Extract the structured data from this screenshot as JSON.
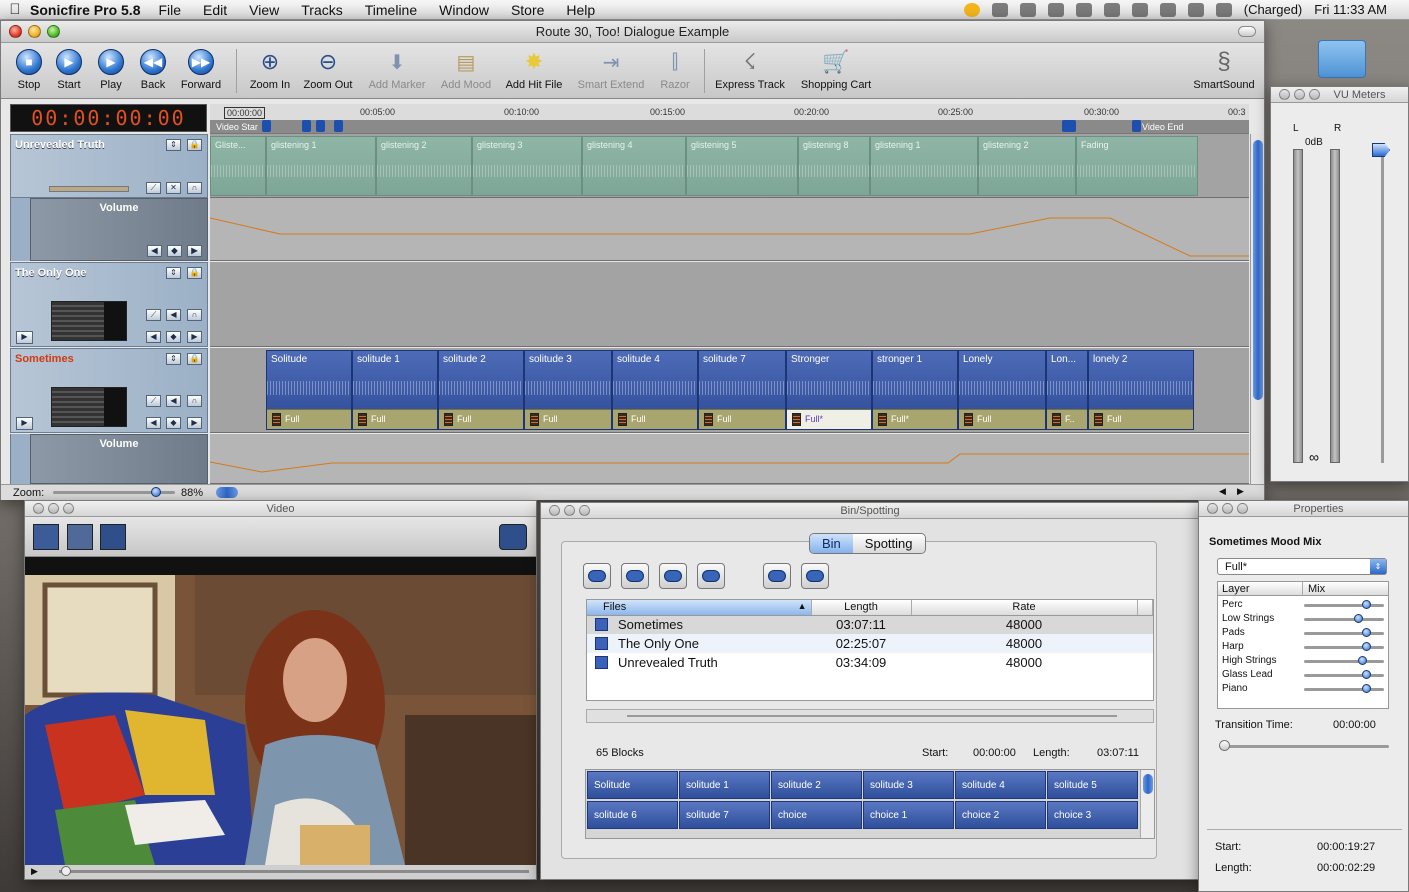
{
  "menubar": {
    "app_name": "Sonicfire Pro 5.8",
    "items": [
      "File",
      "Edit",
      "View",
      "Tracks",
      "Timeline",
      "Window",
      "Store",
      "Help"
    ],
    "battery": "(Charged)",
    "clock": "Fri 11:33 AM"
  },
  "main_window": {
    "title": "Route 30, Too! Dialogue Example",
    "toolbar": {
      "stop": "Stop",
      "start": "Start",
      "play": "Play",
      "back": "Back",
      "forward": "Forward",
      "zoom_in": "Zoom In",
      "zoom_out": "Zoom Out",
      "add_marker": "Add Marker",
      "add_mood": "Add Mood",
      "add_hit_file": "Add Hit File",
      "smart_extend": "Smart Extend",
      "razor": "Razor",
      "express_track": "Express Track",
      "shopping_cart": "Shopping Cart",
      "smartsound": "SmartSound"
    },
    "timecode": "00:00:00:00",
    "ruler_ticks": [
      "00:00:00",
      "00:05:00",
      "00:10:00",
      "00:15:00",
      "00:20:00",
      "00:25:00",
      "00:30:00",
      "00:3"
    ],
    "video_start": "Video Star",
    "video_end": "Video End",
    "tracks": {
      "unrevealed": {
        "name": "Unrevealed Truth",
        "blocks": [
          "Gliste...",
          "glistening 1",
          "glistening 2",
          "glistening 3",
          "glistening 4",
          "glistening 5",
          "glistening 8",
          "glistening 1",
          "glistening 2",
          "Fading"
        ]
      },
      "volume_label": "Volume",
      "only_one": {
        "name": "The Only One"
      },
      "sometimes": {
        "name": "Sometimes",
        "blocks": [
          "Solitude",
          "solitude 1",
          "solitude 2",
          "solitude 3",
          "solitude 4",
          "solitude 7",
          "Stronger",
          "stronger 1",
          "Lonely",
          "Lon...",
          "lonely 2"
        ],
        "moods": [
          "Full",
          "Full",
          "Full",
          "Full",
          "Full",
          "Full",
          "Full*",
          "Full*",
          "Full",
          "F..",
          "Full"
        ]
      }
    },
    "zoom_label": "Zoom:",
    "zoom_value": "88%"
  },
  "vu_meters": {
    "title": "VU Meters",
    "left": "L",
    "right": "R",
    "odb": "0dB",
    "infinity": "∞"
  },
  "video_window": {
    "title": "Video"
  },
  "bin_window": {
    "title": "Bin/Spotting",
    "tab_bin": "Bin",
    "tab_spotting": "Spotting",
    "columns": {
      "files": "Files",
      "length": "Length",
      "rate": "Rate"
    },
    "files": [
      {
        "name": "Sometimes",
        "length": "03:07:11",
        "rate": "48000"
      },
      {
        "name": "The Only One",
        "length": "02:25:07",
        "rate": "48000"
      },
      {
        "name": "Unrevealed Truth",
        "length": "03:34:09",
        "rate": "48000"
      }
    ],
    "blocks_count": "65 Blocks",
    "start_label": "Start:",
    "start_value": "00:00:00",
    "length_label": "Length:",
    "length_value": "03:07:11",
    "blocks": [
      "Solitude",
      "solitude 1",
      "solitude 2",
      "solitude 3",
      "solitude 4",
      "solitude 5",
      "solitude 6",
      "solitude 7",
      "choice",
      "choice 1",
      "choice 2",
      "choice 3"
    ]
  },
  "properties": {
    "title": "Properties",
    "heading": "Sometimes Mood Mix",
    "mood_select": "Full*",
    "col_layer": "Layer",
    "col_mix": "Mix",
    "layers": [
      {
        "name": "Perc",
        "mix": 0.8
      },
      {
        "name": "Low Strings",
        "mix": 0.7
      },
      {
        "name": "Pads",
        "mix": 0.8
      },
      {
        "name": "Harp",
        "mix": 0.8
      },
      {
        "name": "High Strings",
        "mix": 0.75
      },
      {
        "name": "Glass Lead",
        "mix": 0.8
      },
      {
        "name": "Piano",
        "mix": 0.8
      }
    ],
    "transition_label": "Transition Time:",
    "transition_value": "00:00:00",
    "start_label": "Start:",
    "start_value": "00:00:19:27",
    "length_label": "Length:",
    "length_value": "00:00:02:29"
  }
}
